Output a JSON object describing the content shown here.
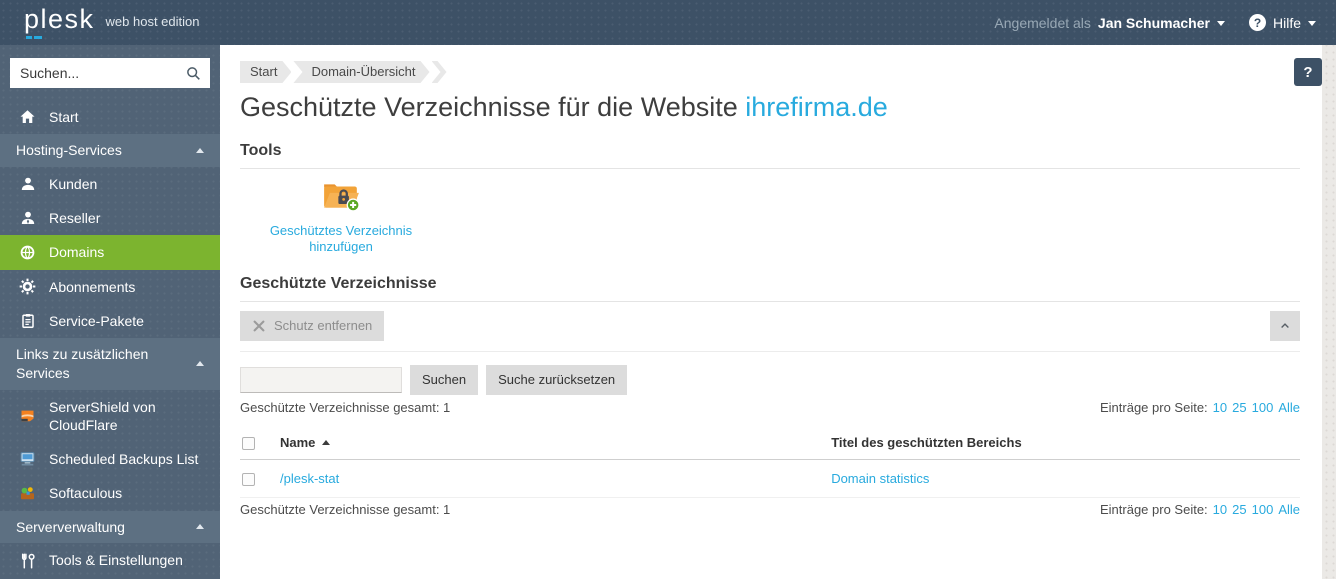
{
  "colors": {
    "accent_blue": "#28aade",
    "active_green": "#7cb42f",
    "topbar_bg": "#3d5166",
    "sidebar_bg": "#516376"
  },
  "topbar": {
    "logo": "plesk",
    "edition": "web host edition",
    "signed_in_label": "Angemeldet als",
    "user_name": "Jan Schumacher",
    "help_icon_glyph": "?",
    "help_label": "Hilfe"
  },
  "sidebar": {
    "search_placeholder": "Suchen...",
    "start_label": "Start",
    "active_item": "Domains",
    "sections": [
      {
        "title": "Hosting-Services",
        "items": [
          "Kunden",
          "Reseller",
          "Domains",
          "Abonnements",
          "Service-Pakete"
        ]
      },
      {
        "title": "Links zu zusätzlichen Services",
        "items": [
          "ServerShield von CloudFlare",
          "Scheduled Backups List",
          "Softaculous"
        ]
      },
      {
        "title": "Serververwaltung",
        "items": [
          "Tools & Einstellungen"
        ]
      }
    ]
  },
  "main": {
    "breadcrumb": [
      "Start",
      "Domain-Übersicht"
    ],
    "title_prefix": "Geschützte Verzeichnisse für die Website",
    "title_domain": "ihrefirma.de",
    "help_button_glyph": "?",
    "tools": {
      "heading": "Tools",
      "add_protected_directory_label": "Geschütztes Verzeichnis hinzufügen"
    },
    "list": {
      "heading": "Geschützte Verzeichnisse",
      "remove_protection_label": "Schutz entfernen",
      "filter_query": "",
      "search_label": "Suchen",
      "reset_label": "Suche zurücksetzen",
      "total_label": "Geschützte Verzeichnisse gesamt: 1",
      "per_page_label": "Einträge pro Seite:",
      "per_page_options": [
        "10",
        "25",
        "100",
        "Alle"
      ],
      "columns": {
        "name": "Name",
        "title": "Titel des geschützten Bereichs"
      },
      "rows": [
        {
          "name": "/plesk-stat",
          "title": "Domain statistics"
        }
      ],
      "footer_total_label": "Geschützte Verzeichnisse gesamt: 1"
    }
  }
}
